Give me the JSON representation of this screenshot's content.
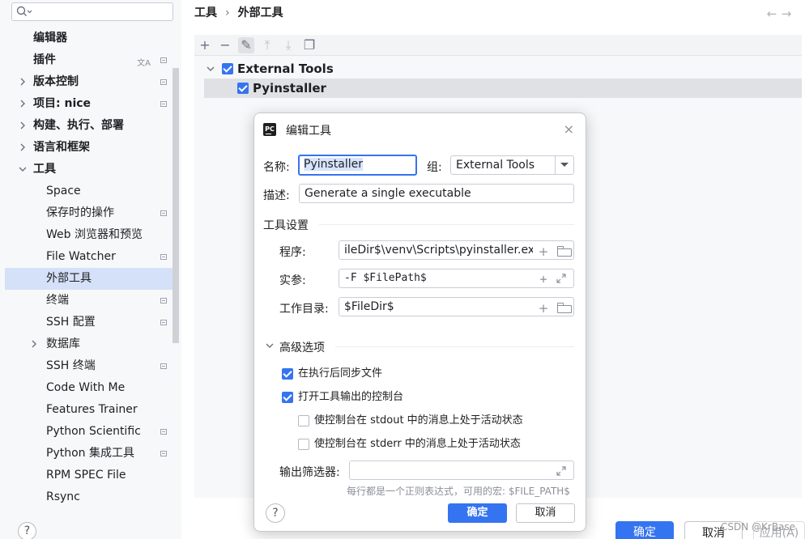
{
  "sidebar": {
    "search_placeholder": "",
    "items": [
      {
        "label": "编辑器",
        "bold": true,
        "indent": 0
      },
      {
        "label": "插件",
        "bold": true,
        "indent": 0
      },
      {
        "label": "版本控制",
        "bold": true,
        "indent": 0
      },
      {
        "label": "项目: nice",
        "bold": true,
        "indent": 0
      },
      {
        "label": "构建、执行、部署",
        "bold": true,
        "indent": 0
      },
      {
        "label": "语言和框架",
        "bold": true,
        "indent": 0
      },
      {
        "label": "工具",
        "bold": true,
        "indent": 0
      },
      {
        "label": "Space",
        "bold": false,
        "indent": 1
      },
      {
        "label": "保存时的操作",
        "bold": false,
        "indent": 1
      },
      {
        "label": "Web 浏览器和预览",
        "bold": false,
        "indent": 1
      },
      {
        "label": "File Watcher",
        "bold": false,
        "indent": 1
      },
      {
        "label": "外部工具",
        "bold": false,
        "indent": 1
      },
      {
        "label": "终端",
        "bold": false,
        "indent": 1
      },
      {
        "label": "SSH 配置",
        "bold": false,
        "indent": 1
      },
      {
        "label": "数据库",
        "bold": false,
        "indent": 1
      },
      {
        "label": "SSH 终端",
        "bold": false,
        "indent": 1
      },
      {
        "label": "Code With Me",
        "bold": false,
        "indent": 1
      },
      {
        "label": "Features Trainer",
        "bold": false,
        "indent": 1
      },
      {
        "label": "Python Scientific",
        "bold": false,
        "indent": 1
      },
      {
        "label": "Python 集成工具",
        "bold": false,
        "indent": 1
      },
      {
        "label": "RPM SPEC File",
        "bold": false,
        "indent": 1
      },
      {
        "label": "Rsync",
        "bold": false,
        "indent": 1
      }
    ],
    "help": "?"
  },
  "breadcrumb": {
    "parent": "工具",
    "separator": "›",
    "current": "外部工具"
  },
  "nav": {
    "back": "←",
    "forward": "→"
  },
  "toolbar": {
    "add": "+",
    "remove": "−",
    "edit": "✎",
    "up": "⤒",
    "down": "⤓",
    "copy": "❐"
  },
  "tree": {
    "group_label": "External Tools",
    "group_checked": true,
    "item_label": "Pyinstaller",
    "item_checked": true
  },
  "main_buttons": {
    "ok": "确定",
    "cancel": "取消",
    "apply": "应用(A)"
  },
  "watermark": "CSDN @KrBase",
  "dialog": {
    "title": "编辑工具",
    "close": "×",
    "name_label": "名称:",
    "name_value": "Pyinstaller",
    "group_label": "组:",
    "group_value": "External Tools",
    "desc_label": "描述:",
    "desc_value": "Generate a single executable",
    "tool_settings_title": "工具设置",
    "program_label": "程序:",
    "program_value": "ileDir$\\venv\\Scripts\\pyinstaller.exe",
    "args_label": "实参:",
    "args_value": "-F $FilePath$",
    "workdir_label": "工作目录:",
    "workdir_value": "$FileDir$",
    "advanced_title": "高级选项",
    "options": [
      {
        "label": "在执行后同步文件",
        "checked": true
      },
      {
        "label": "打开工具输出的控制台",
        "checked": true
      },
      {
        "label": "使控制台在 stdout 中的消息上处于活动状态",
        "checked": false
      },
      {
        "label": "使控制台在 stderr 中的消息上处于活动状态",
        "checked": false
      }
    ],
    "output_filter_label": "输出筛选器:",
    "output_filter_value": "",
    "hint": "每行都是一个正则表达式，可用的宏: $FILE_PATH$",
    "help": "?",
    "ok": "确定",
    "cancel": "取消"
  },
  "colors": {
    "accent": "#3574f0",
    "selection": "#d5e1f8",
    "sidebar_bg": "#f7f8fa"
  }
}
